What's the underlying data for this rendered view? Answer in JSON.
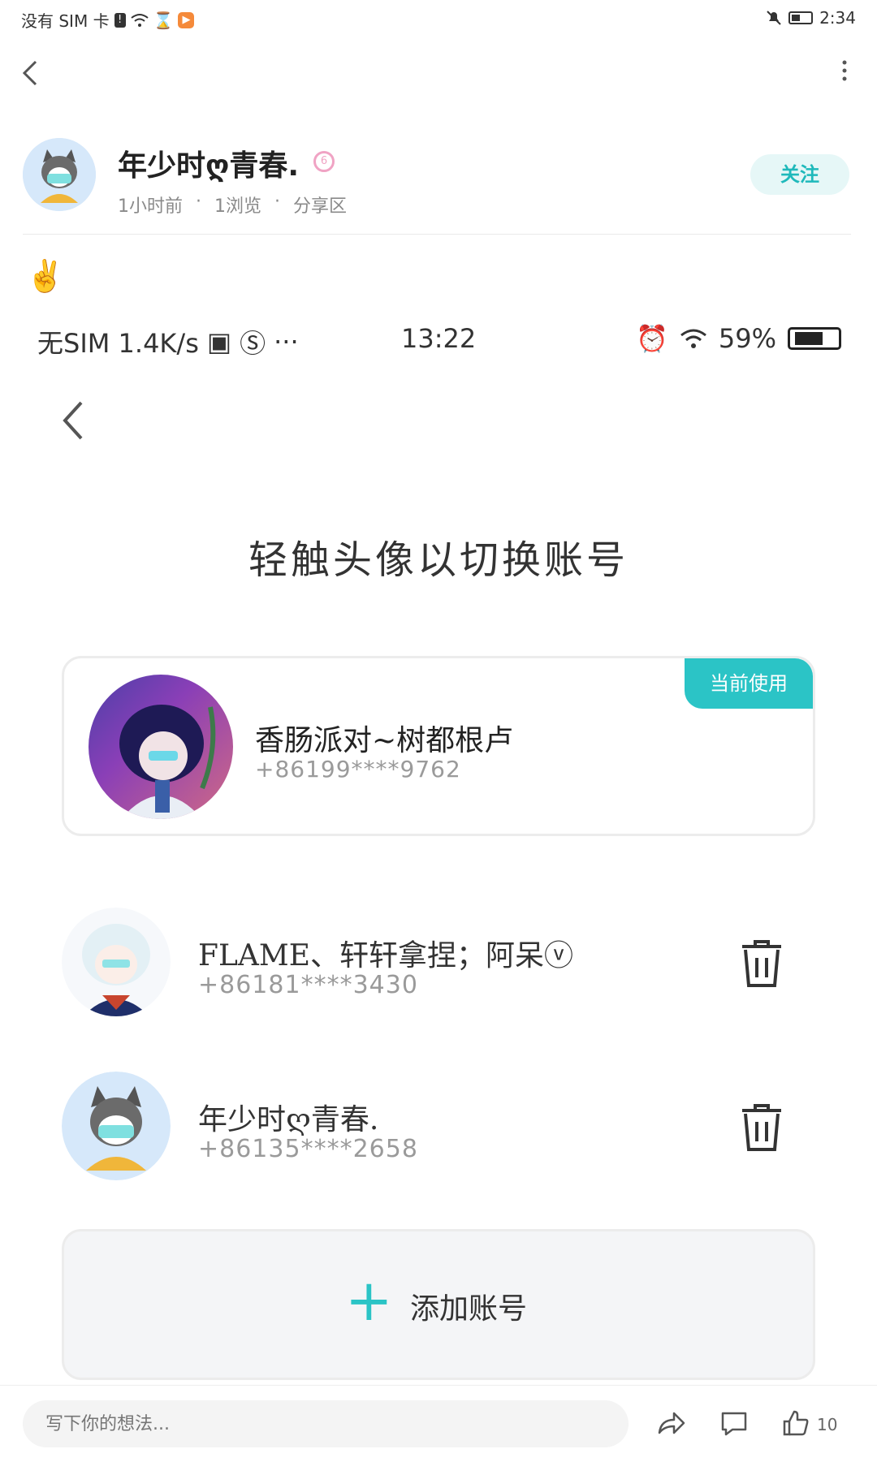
{
  "status_bar": {
    "carrier": "没有 SIM 卡",
    "time": "2:34"
  },
  "post": {
    "author": "年少时ღ青春.",
    "time_ago": "1小时前",
    "views": "1浏览",
    "section": "分享区",
    "follow_label": "关注",
    "emoji": "✌️"
  },
  "embedded_screenshot": {
    "status": {
      "left": "无SIM 1.4K/s",
      "time": "13:22",
      "battery": "59%"
    },
    "title": "轻触头像以切换账号",
    "current_tag": "当前使用",
    "accounts": [
      {
        "name": "香肠派对~树都根卢",
        "phone": "+86199****9762"
      },
      {
        "name": "FLAME、轩轩拿捏；阿呆ⓥ",
        "phone": "+86181****3430"
      },
      {
        "name": "年少时ღ青春.",
        "phone": "+86135****2658"
      }
    ],
    "add_label": "添加账号"
  },
  "bottom": {
    "comment_placeholder": "写下你的想法...",
    "like_count": "10"
  },
  "colors": {
    "accent": "#2bc4c6",
    "follow_bg": "#e6f7f7"
  }
}
